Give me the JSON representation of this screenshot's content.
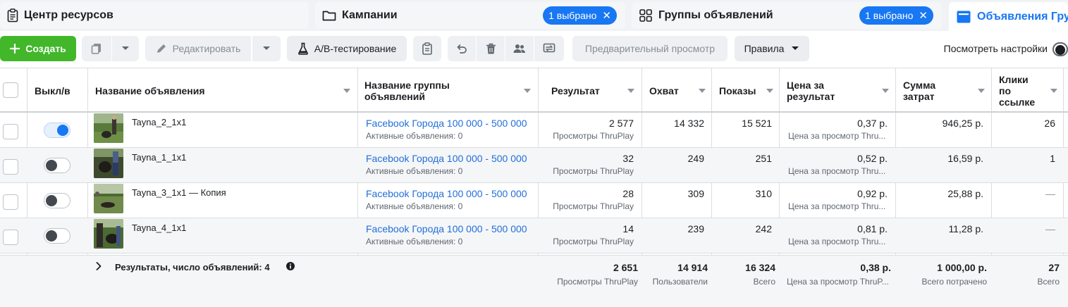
{
  "tabs": [
    {
      "label": "Центр ресурсов"
    },
    {
      "label": "Кампании",
      "badge": "1 выбрано"
    },
    {
      "label": "Группы объявлений",
      "badge": "1 выбрано"
    },
    {
      "label": "Объявления Гру"
    }
  ],
  "toolbar": {
    "create": "Создать",
    "edit": "Редактировать",
    "ab_test": "A/B-тестирование",
    "preview": "Предварительный просмотр",
    "rules": "Правила",
    "view_settings": "Посмотреть настройки"
  },
  "columns": {
    "toggle": "Выкл/в",
    "ad_name": "Название объявления",
    "adset_name_1": "Название группы",
    "adset_name_2": "объявлений",
    "result": "Результат",
    "reach": "Охват",
    "impressions": "Показы",
    "cpr_1": "Цена за",
    "cpr_2": "результат",
    "spend_1": "Сумма",
    "spend_2": "затрат",
    "clicks_1": "Клики",
    "clicks_2": "по",
    "clicks_3": "ссылке"
  },
  "rows": [
    {
      "name": "Tayna_2_1x1",
      "on": true,
      "adset": "Facebook Города 100 000 - 500 000",
      "adset_sub": "Активные объявления: 0",
      "result": "2 577",
      "result_sub": "Просмотры ThruPlay",
      "reach": "14 332",
      "impressions": "15 521",
      "cpr": "0,37 р.",
      "cpr_sub": "Цена за просмотр Thru...",
      "spend": "946,25 р.",
      "clicks": "26"
    },
    {
      "name": "Tayna_1_1x1",
      "on": false,
      "adset": "Facebook Города 100 000 - 500 000",
      "adset_sub": "Активные объявления: 0",
      "result": "32",
      "result_sub": "Просмотры ThruPlay",
      "reach": "249",
      "impressions": "251",
      "cpr": "0,52 р.",
      "cpr_sub": "Цена за просмотр Thru...",
      "spend": "16,59 р.",
      "clicks": "1"
    },
    {
      "name": "Tayna_3_1x1 — Копия",
      "on": false,
      "adset": "Facebook Города 100 000 - 500 000",
      "adset_sub": "Активные объявления: 0",
      "result": "28",
      "result_sub": "Просмотры ThruPlay",
      "reach": "309",
      "impressions": "310",
      "cpr": "0,92 р.",
      "cpr_sub": "Цена за просмотр Thru...",
      "spend": "25,88 р.",
      "clicks": "—"
    },
    {
      "name": "Tayna_4_1x1",
      "on": false,
      "adset": "Facebook Города 100 000 - 500 000",
      "adset_sub": "Активные объявления: 0",
      "result": "14",
      "result_sub": "Просмотры ThruPlay",
      "reach": "239",
      "impressions": "242",
      "cpr": "0,81 р.",
      "cpr_sub": "Цена за просмотр Thru...",
      "spend": "11,28 р.",
      "clicks": "—"
    }
  ],
  "summary": {
    "label": "Результаты, число объявлений: 4",
    "result": "2 651",
    "result_sub": "Просмотры ThruPlay",
    "reach": "14 914",
    "reach_sub": "Пользователи",
    "impressions": "16 324",
    "impressions_sub": "Всего",
    "cpr": "0,38 р.",
    "cpr_sub": "Цена за просмотр ThruP...",
    "spend": "1 000,00 р.",
    "spend_sub": "Всего потрачено",
    "clicks": "27",
    "clicks_sub": "Всего"
  },
  "colors": {
    "accent": "#1877f2",
    "create": "#42b72a",
    "link": "#216fdb"
  }
}
